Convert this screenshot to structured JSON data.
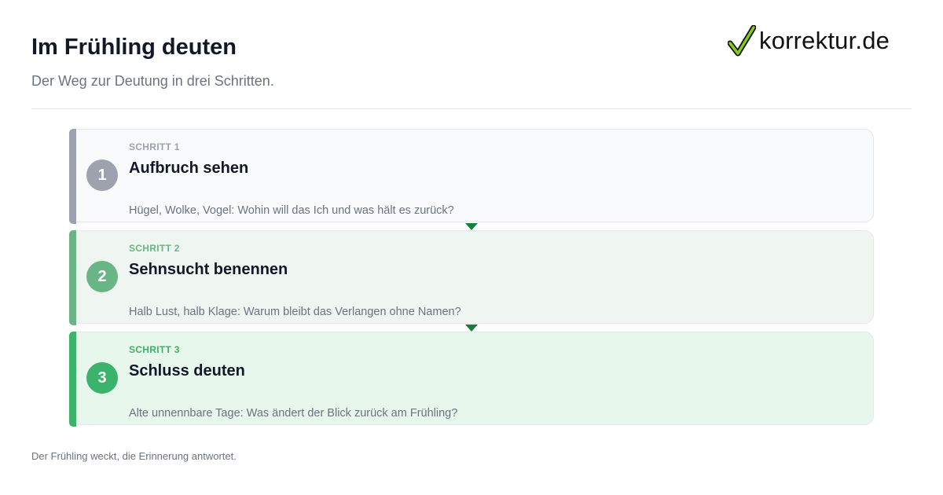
{
  "header": {
    "title": "Im Frühling deuten",
    "subtitle": "Der Weg zur Deutung in drei Schritten."
  },
  "brand": {
    "name": "korrektur.de",
    "icon": "checkmark-icon",
    "check_color": "#84cc16"
  },
  "steps": [
    {
      "number": "1",
      "kicker": "SCHRITT 1",
      "title": "Aufbruch sehen",
      "description": "Hügel, Wolke, Vogel: Wohin will das Ich und was hält es zurück?",
      "accent": "#9ca3af",
      "kicker_color": "#9ca3af",
      "background": "#f8fafc"
    },
    {
      "number": "2",
      "kicker": "SCHRITT 2",
      "title": "Sehnsucht benennen",
      "description": "Halb Lust, halb Klage: Warum bleibt das Verlangen ohne Namen?",
      "accent": "#6ab585",
      "kicker_color": "#6ab585",
      "background": "#eff6f1"
    },
    {
      "number": "3",
      "kicker": "SCHRITT 3",
      "title": "Schluss deuten",
      "description": "Alte unnennbare Tage: Was ändert der Blick zurück am Frühling?",
      "accent": "#3bb36b",
      "kicker_color": "#3bb36b",
      "background": "#e8f7ec"
    }
  ],
  "connector_color": "#15803d",
  "footer": {
    "text": "Der Frühling weckt, die Erinnerung antwortet."
  }
}
